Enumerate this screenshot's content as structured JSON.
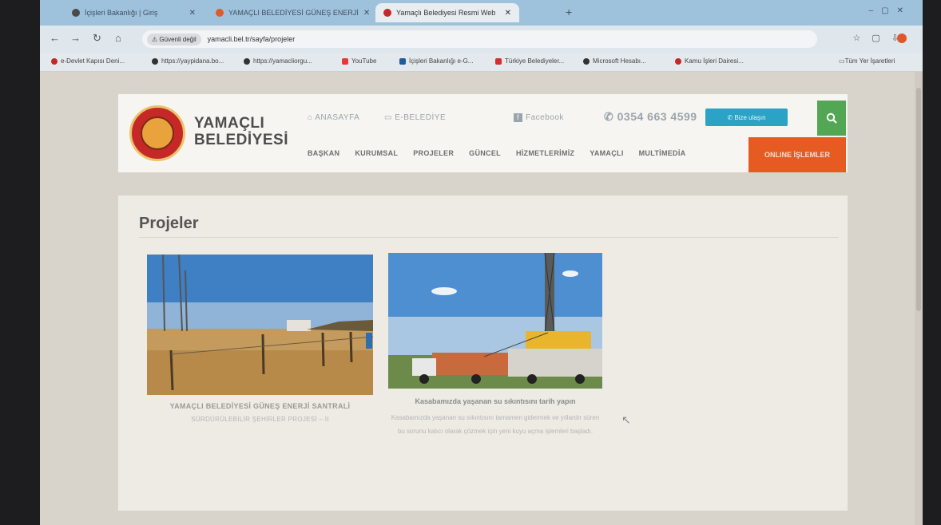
{
  "browser": {
    "tabs": [
      {
        "label": "İçişleri Bakanlığı | Giriş",
        "favicon_color": "#4a4a4a"
      },
      {
        "label": "YAMAÇLI BELEDİYESİ GÜNEŞ ENERJİ",
        "favicon_color": "#e05a2a"
      },
      {
        "label": "Yamaçlı Belediyesi Resmi Web",
        "favicon_color": "#c62828"
      }
    ],
    "new_tab": "+",
    "security_label": "Güvenli değil",
    "url": "yamacli.bel.tr/sayfa/projeler",
    "bookmarks": [
      {
        "label": "e-Devlet Kapısı Deni...",
        "color": "#c62828"
      },
      {
        "label": "https://yaypidana.bo...",
        "color": "#333333"
      },
      {
        "label": "https://yamacliorgu...",
        "color": "#333333"
      },
      {
        "label": "YouTube",
        "color": "#e53935"
      },
      {
        "label": "İçişleri Bakanlığı e-G...",
        "color": "#1e5c9c"
      },
      {
        "label": "Türkiye Belediyeler...",
        "color": "#d32f2f"
      },
      {
        "label": "Microsoft Hesabı...",
        "color": "#333333"
      },
      {
        "label": "Kamu İşleri Dairesi...",
        "color": "#c62828"
      }
    ],
    "all_bookmarks": "Tüm Yer İşaretleri"
  },
  "site": {
    "brand_line1": "YAMAÇLI",
    "brand_line2": "BELEDİYESİ",
    "home_link": "⌂ ANASAYFA",
    "ebelediye_link": "▭ E-BELEDİYE",
    "facebook_link": "Facebook",
    "phone": "✆ 0354 663 4599",
    "contact_button": "✆ Bize ulaşın",
    "menu": [
      "BAŞKAN",
      "KURUMSAL",
      "PROJELER",
      "GÜNCEL",
      "HİZMETLERİMİZ",
      "YAMAÇLI",
      "MULTİMEDİA"
    ],
    "online_button": "ONLINE İŞLEMLER"
  },
  "content": {
    "title": "Projeler",
    "projects": [
      {
        "caption": "YAMAÇLI BELEDİYESİ GÜNEŞ ENERJİ SANTRALİ",
        "subtitle": "SÜRDÜRÜLEBİLİR ŞEHİRLER PROJESİ – II"
      },
      {
        "caption": "Kasabamızda yaşanan su sıkıntısını tarih yapın",
        "description": "Kasabamızda yaşanan su sıkıntısını tamamen gidermek ve yıllardır süren bu sorunu kalıcı olarak çözmek için yeni kuyu açma işlemleri başladı."
      }
    ]
  },
  "colors": {
    "accent_blue": "#2ba3c7",
    "accent_green": "#53a653",
    "accent_orange": "#e65b22",
    "logo_red": "#c62828"
  }
}
